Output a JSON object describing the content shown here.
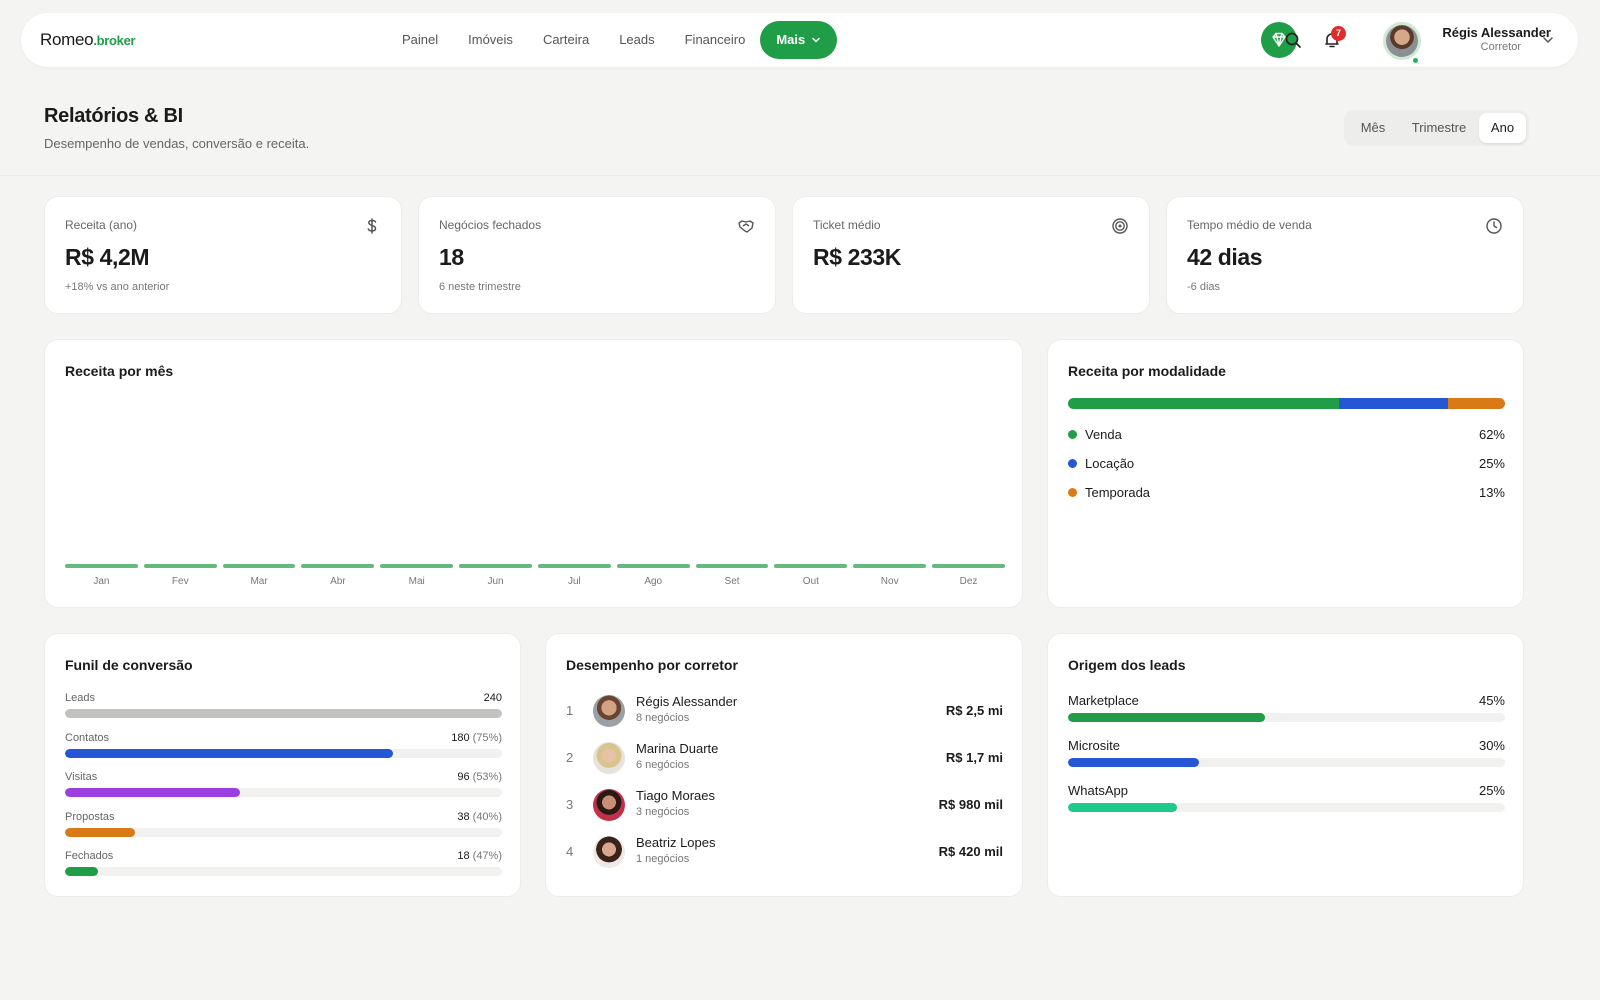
{
  "brand": {
    "name": "Romeo",
    "suffix": ".broker"
  },
  "nav": {
    "items": [
      "Painel",
      "Imóveis",
      "Carteira",
      "Leads",
      "Financeiro"
    ],
    "more_label": "Mais",
    "active": "Mais"
  },
  "header_actions": {
    "notification_count": "7"
  },
  "user": {
    "name": "Régis Alessander",
    "role": "Corretor"
  },
  "page": {
    "title": "Relatórios & BI",
    "subtitle": "Desempenho de vendas, conversão e receita.",
    "period_options": [
      "Mês",
      "Trimestre",
      "Ano"
    ],
    "period_selected": "Ano"
  },
  "kpis": [
    {
      "label": "Receita (ano)",
      "value": "R$ 4,2M",
      "sub": "+18% vs ano anterior",
      "icon": "dollar-icon"
    },
    {
      "label": "Negócios fechados",
      "value": "18",
      "sub": "6 neste trimestre",
      "icon": "handshake-icon"
    },
    {
      "label": "Ticket médio",
      "value": "R$ 233K",
      "sub": "",
      "icon": "target-icon"
    },
    {
      "label": "Tempo médio de venda",
      "value": "42 dias",
      "sub": "-6 dias",
      "icon": "clock-icon"
    }
  ],
  "revenue_chart": {
    "title": "Receita por mês",
    "months": [
      "Jan",
      "Fev",
      "Mar",
      "Abr",
      "Mai",
      "Jun",
      "Jul",
      "Ago",
      "Set",
      "Out",
      "Nov",
      "Dez"
    ],
    "color": "#1f9d47"
  },
  "modalidade": {
    "title": "Receita por modalidade",
    "items": [
      {
        "label": "Venda",
        "pct": "62%",
        "share": 62,
        "color": "#1f9d47"
      },
      {
        "label": "Locação",
        "pct": "25%",
        "share": 25,
        "color": "#2456d6"
      },
      {
        "label": "Temporada",
        "pct": "13%",
        "share": 13,
        "color": "#d97a16"
      }
    ]
  },
  "funnel": {
    "title": "Funil de conversão",
    "stages": [
      {
        "label": "Leads",
        "value": "240",
        "pct": "",
        "fill": 100,
        "color": "#c2c2c0"
      },
      {
        "label": "Contatos",
        "value": "180",
        "pct": "(75%)",
        "fill": 75,
        "color": "#2456d6"
      },
      {
        "label": "Visitas",
        "value": "96",
        "pct": "(53%)",
        "fill": 40,
        "color": "#9b3fe0"
      },
      {
        "label": "Propostas",
        "value": "38",
        "pct": "(40%)",
        "fill": 16,
        "color": "#d97a16"
      },
      {
        "label": "Fechados",
        "value": "18",
        "pct": "(47%)",
        "fill": 7.5,
        "color": "#1f9d47"
      }
    ]
  },
  "brokers": {
    "title": "Desempenho por corretor",
    "rows": [
      {
        "rank": "1",
        "name": "Régis Alessander",
        "deals": "8 negócios",
        "value": "R$ 2,5 mi"
      },
      {
        "rank": "2",
        "name": "Marina Duarte",
        "deals": "6 negócios",
        "value": "R$ 1,7 mi"
      },
      {
        "rank": "3",
        "name": "Tiago Moraes",
        "deals": "3 negócios",
        "value": "R$ 980 mil"
      },
      {
        "rank": "4",
        "name": "Beatriz Lopes",
        "deals": "1 negócios",
        "value": "R$ 420 mil"
      }
    ]
  },
  "lead_sources": {
    "title": "Origem dos leads",
    "items": [
      {
        "label": "Marketplace",
        "pct": "45%",
        "fill": 45,
        "color": "#1f9d47"
      },
      {
        "label": "Microsite",
        "pct": "30%",
        "fill": 30,
        "color": "#2456d6"
      },
      {
        "label": "WhatsApp",
        "pct": "25%",
        "fill": 25,
        "color": "#1ec98a"
      }
    ]
  }
}
